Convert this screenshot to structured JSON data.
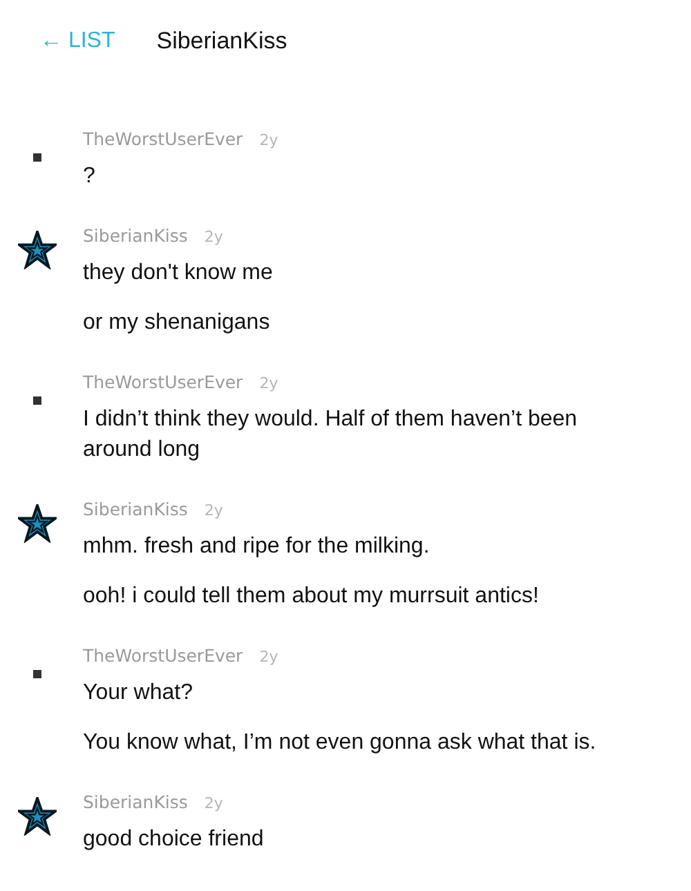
{
  "header": {
    "back_label": "← LIST",
    "title": "SiberianKiss"
  },
  "posts": [
    {
      "avatar": {
        "kind": "square"
      },
      "user": "TheWorstUserEver",
      "time": "2y",
      "messages": [
        "?"
      ]
    },
    {
      "avatar": {
        "kind": "star"
      },
      "user": "SiberianKiss",
      "time": "2y",
      "messages": [
        "they don't know me",
        "or my shenanigans"
      ]
    },
    {
      "avatar": {
        "kind": "square"
      },
      "user": "TheWorstUserEver",
      "time": "2y",
      "messages": [
        "I didn’t think they would. Half of them haven’t been around long"
      ]
    },
    {
      "avatar": {
        "kind": "star"
      },
      "user": "SiberianKiss",
      "time": "2y",
      "messages": [
        "mhm. fresh and ripe for the milking.",
        "ooh! i could tell them about my murrsuit antics!"
      ]
    },
    {
      "avatar": {
        "kind": "square"
      },
      "user": "TheWorstUserEver",
      "time": "2y",
      "messages": [
        "Your what?",
        "You know what, I’m not even gonna ask what that is."
      ]
    },
    {
      "avatar": {
        "kind": "star"
      },
      "user": "SiberianKiss",
      "time": "2y",
      "messages": [
        "good choice friend"
      ]
    }
  ]
}
